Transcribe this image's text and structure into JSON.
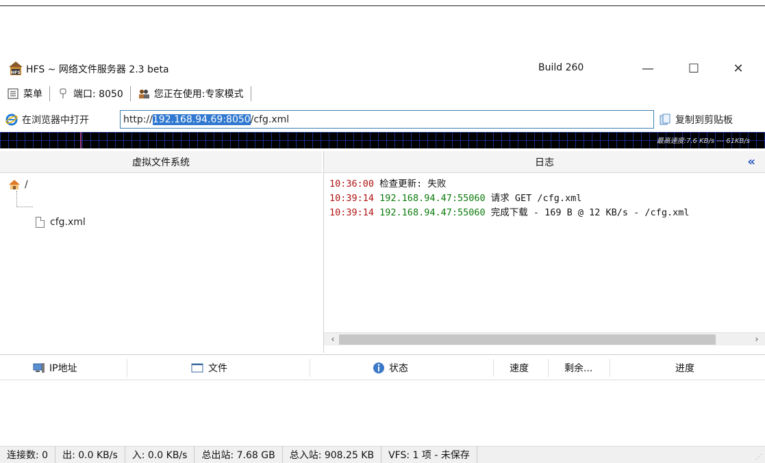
{
  "window": {
    "title": "HFS ~ 网络文件服务器 2.3 beta",
    "build": "Build 260",
    "minimize": "—",
    "maximize": "☐",
    "close": "✕"
  },
  "menubar": {
    "menu_label": "菜单",
    "port_label": "端口: 8050",
    "mode_label": "您正在使用:专家模式"
  },
  "urlbar": {
    "open_label": "在浏览器中打开",
    "url_prefix": "http://",
    "url_host": "192.168.94.69:8050",
    "url_path": "/cfg.xml",
    "copy_label": "复制到剪贴板"
  },
  "graph": {
    "max_speed": "最高速度:7.6 KB/s --- 61KB/s"
  },
  "vfs": {
    "header": "虚拟文件系统",
    "root": "/",
    "children": [
      "cfg.xml"
    ]
  },
  "log": {
    "header": "日志",
    "collapse": "«",
    "entries": [
      {
        "time": "10:36:00",
        "ip": "",
        "msg": "检查更新: 失败"
      },
      {
        "time": "10:39:14",
        "ip": "192.168.94.47:55060",
        "msg": "请求 GET /cfg.xml"
      },
      {
        "time": "10:39:14",
        "ip": "192.168.94.47:55060",
        "msg": "完成下载 - 169 B @ 12 KB/s - /cfg.xml"
      }
    ]
  },
  "connections": {
    "columns": [
      "IP地址",
      "文件",
      "状态",
      "速度",
      "剩余...",
      "进度"
    ]
  },
  "statusbar": {
    "connections": "连接数: 0",
    "out": "出: 0.0 KB/s",
    "in": "入: 0.0 KB/s",
    "total_out": "总出站: 7.68 GB",
    "total_in": "总入站: 908.25 KB",
    "vfs": "VFS: 1 项 - 未保存"
  }
}
